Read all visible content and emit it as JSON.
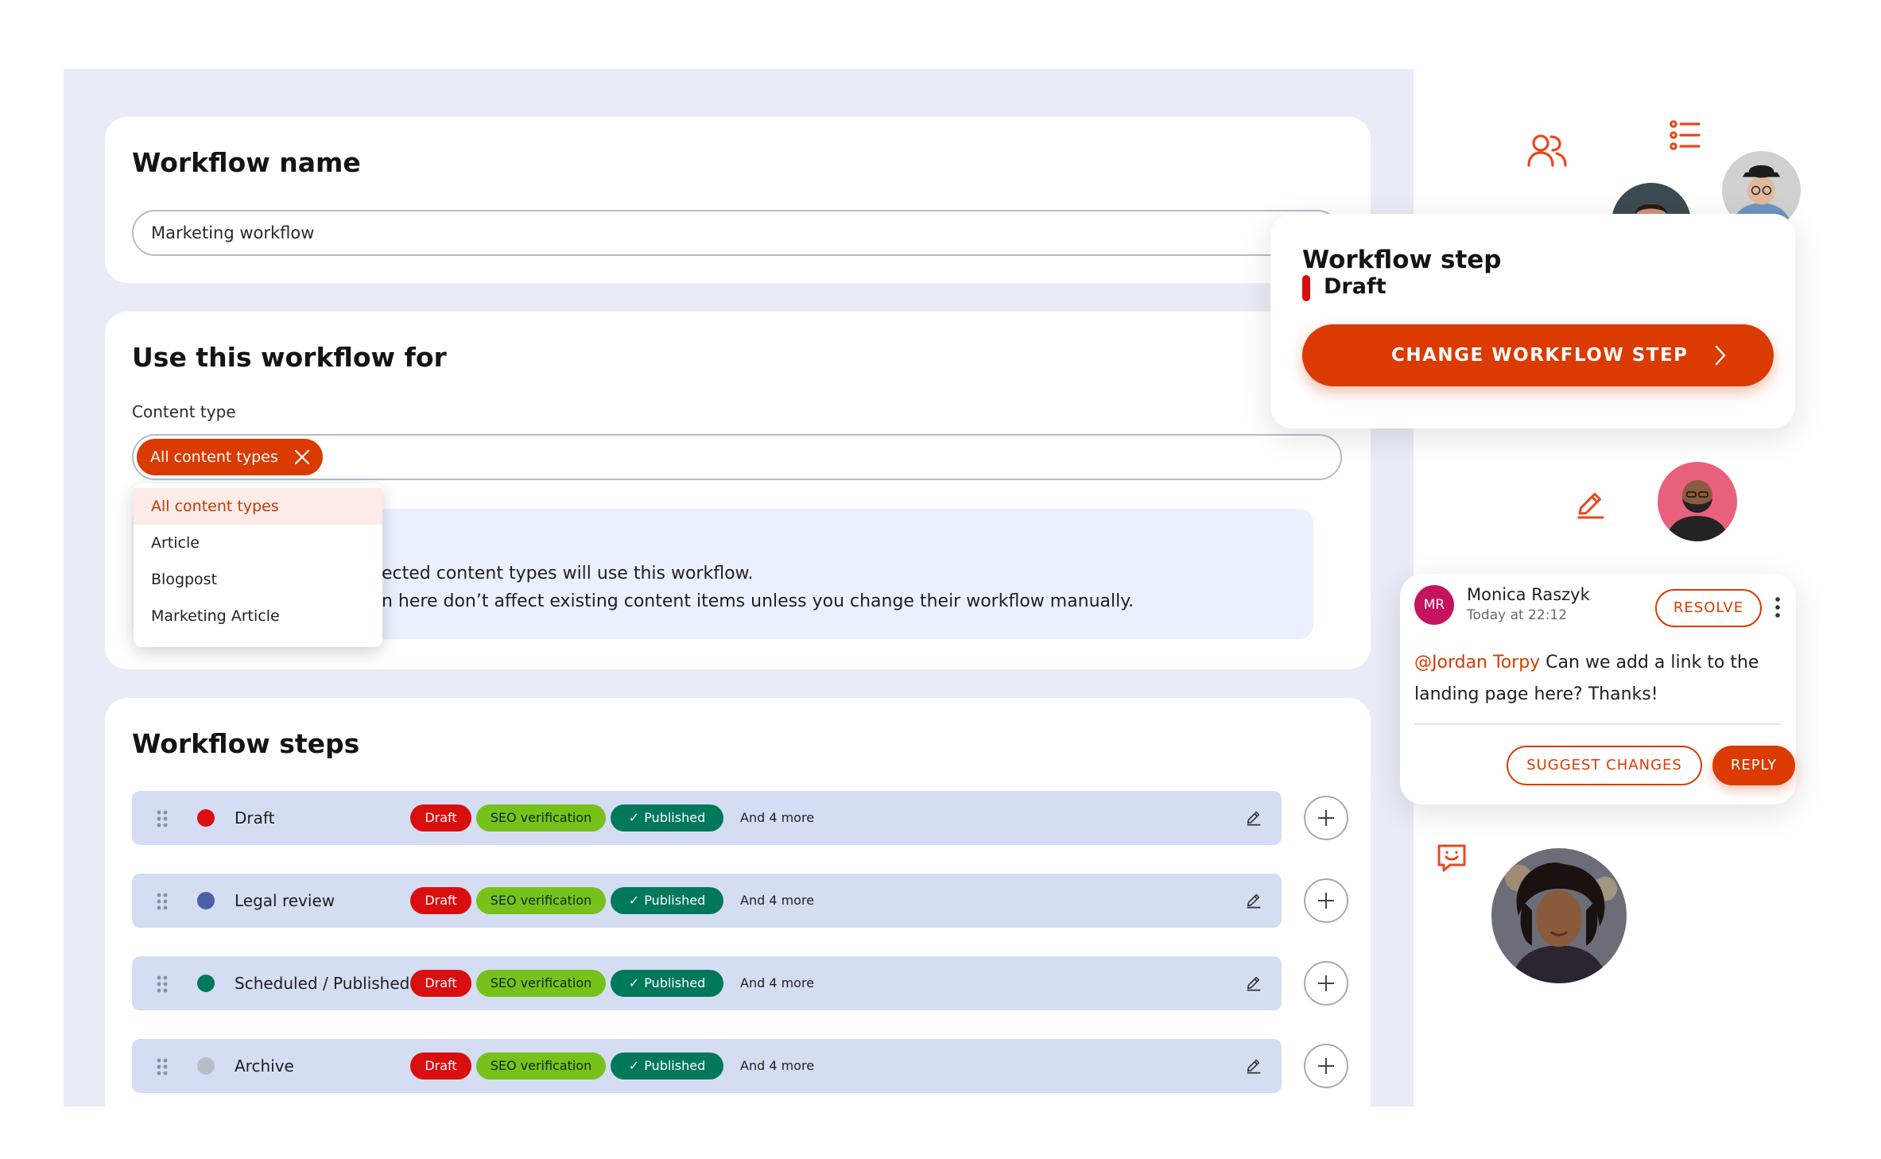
{
  "workflow_name": {
    "heading": "Workflow name",
    "input_value": "Marketing workflow"
  },
  "use_for": {
    "heading": "Use this workflow for",
    "content_type_label": "Content type",
    "chip_label": "All content types",
    "info_line_1": "ected content types will use this workflow.",
    "info_line_2": "n here don’t affect existing content items unless you change their workflow manually."
  },
  "dropdown": {
    "options": [
      "All content types",
      "Article",
      "Blogpost",
      "Marketing Article"
    ],
    "active_index": 0
  },
  "steps": {
    "heading": "Workflow steps",
    "tag_draft": "Draft",
    "tag_seo": "SEO verification",
    "tag_published": "Published",
    "more_label": "And 4 more",
    "items": [
      {
        "name": "Draft",
        "color": "#d90f0f"
      },
      {
        "name": "Legal review",
        "color": "#4a62a3"
      },
      {
        "name": "Scheduled / Published",
        "color": "#00785a"
      },
      {
        "name": "Archive",
        "color": "#b8bcc7"
      }
    ]
  },
  "workflow_step_card": {
    "title": "Workflow step",
    "current_step": "Draft",
    "current_step_color": "#d90f0f",
    "button_label": "CHANGE WORKFLOW STEP"
  },
  "comment": {
    "avatar_initials": "MR",
    "author": "Monica Raszyk",
    "timestamp": "Today at 22:12",
    "resolve_label": "RESOLVE",
    "mention": "@Jordan Torpy",
    "text": " Can we add a link to the landing page here? Thanks!",
    "suggest_label": "SUGGEST CHANGES",
    "reply_label": "REPLY"
  },
  "colors": {
    "accent": "#db3a00",
    "panel_bg": "#e8ecf6",
    "row_bg": "#d4ddf2",
    "tag_draft": "#d90f0f",
    "tag_seo": "#76c21b",
    "tag_published": "#00785a"
  },
  "icons": [
    "users-icon",
    "list-icon",
    "pencil-icon",
    "chat-smile-icon",
    "close-icon",
    "drag-handle-icon",
    "edit-icon",
    "plus-icon",
    "check-icon",
    "chevron-right-icon",
    "more-vertical-icon"
  ]
}
